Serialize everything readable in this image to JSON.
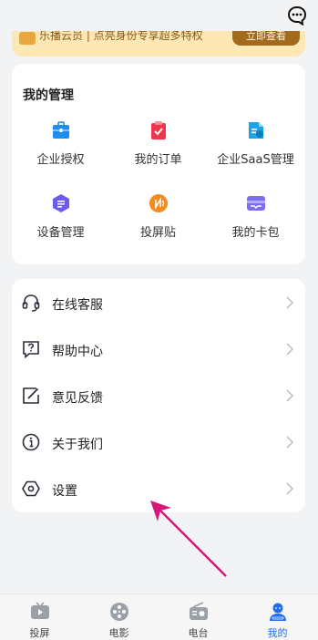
{
  "header": {
    "chat_icon": "chat-bubble-icon"
  },
  "vip_banner": {
    "text": "乐播云员  | 点亮身份专享超多特权",
    "button_label": "立即查看",
    "accent": "#fde7b4"
  },
  "manage": {
    "title": "我的管理",
    "items": [
      {
        "label": "企业授权",
        "icon": "briefcase-icon",
        "color": "#1f8cf0"
      },
      {
        "label": "我的订单",
        "icon": "clipboard-check-icon",
        "color": "#f0364e"
      },
      {
        "label": "企业SaaS管理",
        "icon": "document-user-icon",
        "color": "#1aa5e8"
      },
      {
        "label": "设备管理",
        "icon": "device-hexagon-icon",
        "color": "#6a5cf0"
      },
      {
        "label": "投屏贴",
        "icon": "nfc-sticker-icon",
        "color": "#f58a1f"
      },
      {
        "label": "我的卡包",
        "icon": "card-wallet-icon",
        "color": "#7b6cf5"
      }
    ]
  },
  "menu": {
    "items": [
      {
        "label": "在线客服",
        "icon": "headset-icon"
      },
      {
        "label": "帮助中心",
        "icon": "help-question-icon"
      },
      {
        "label": "意见反馈",
        "icon": "edit-feedback-icon"
      },
      {
        "label": "关于我们",
        "icon": "info-icon"
      },
      {
        "label": "设置",
        "icon": "settings-hexagon-icon"
      }
    ]
  },
  "bottom_nav": {
    "items": [
      {
        "label": "投屏",
        "icon": "tv-cast-icon",
        "active": false
      },
      {
        "label": "电影",
        "icon": "film-reel-icon",
        "active": false
      },
      {
        "label": "电台",
        "icon": "radio-icon",
        "active": false
      },
      {
        "label": "我的",
        "icon": "user-profile-icon",
        "active": true
      }
    ],
    "active_color": "#1d6ef5"
  },
  "annotation": {
    "arrow_color": "#d6187a"
  }
}
